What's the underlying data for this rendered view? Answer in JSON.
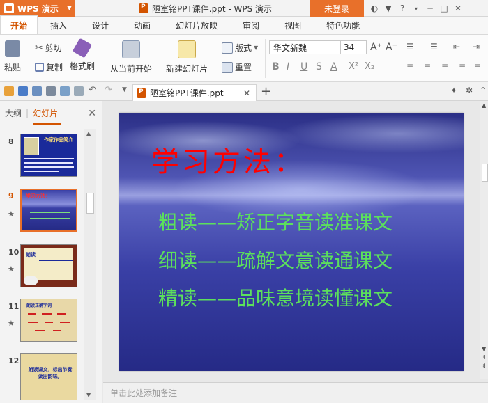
{
  "titlebar": {
    "app_name": "WPS 演示",
    "doc_title": "陋室铭PPT课件.ppt - WPS 演示",
    "login": "未登录"
  },
  "menu": {
    "tabs": [
      "开始",
      "插入",
      "设计",
      "动画",
      "幻灯片放映",
      "审阅",
      "视图",
      "特色功能"
    ]
  },
  "ribbon": {
    "paste": "粘贴",
    "cut": "剪切",
    "copy": "复制",
    "format_painter": "格式刷",
    "from_current": "从当前开始",
    "new_slide": "新建幻灯片",
    "layout": "版式",
    "reset": "重置",
    "font_name": "华文新魏",
    "font_size": "34"
  },
  "doctab": {
    "name": "陋室铭PPT课件.ppt"
  },
  "leftpanel": {
    "outline_tab": "大纲",
    "slides_tab": "幻灯片",
    "thumbnails": [
      {
        "num": "8",
        "title": "作家作品简介"
      },
      {
        "num": "9",
        "title": "学习方法："
      },
      {
        "num": "10",
        "title": "朗读"
      },
      {
        "num": "11",
        "title": "朗读正确字词"
      },
      {
        "num": "12",
        "title": "朗读课文，标出节奏读出韵味。"
      }
    ]
  },
  "slide": {
    "title": "学习方法：",
    "lines": [
      "粗读——矫正字音读准课文",
      "细读——疏解文意读通课文",
      "精读——品味意境读懂课文"
    ]
  },
  "notes": {
    "placeholder": "单击此处添加备注"
  },
  "colors": {
    "accent": "#e8702a",
    "slide_title": "#ff0000",
    "slide_text": "#5ce05c"
  }
}
